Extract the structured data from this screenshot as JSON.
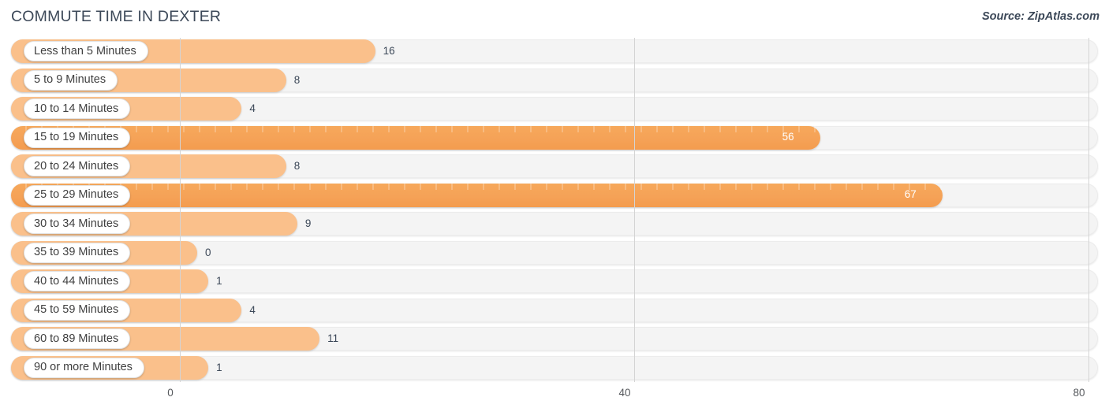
{
  "header": {
    "title": "COMMUTE TIME IN DEXTER",
    "source": "Source: ZipAtlas.com"
  },
  "chart_data": {
    "type": "bar",
    "orientation": "horizontal",
    "title": "COMMUTE TIME IN DEXTER",
    "subtitle": "",
    "source": "Source: ZipAtlas.com",
    "xlabel": "",
    "ylabel": "",
    "xlim": [
      0,
      80
    ],
    "xticks": [
      "0",
      "40",
      "80"
    ],
    "xtick_values": [
      0,
      40,
      80
    ],
    "grid": true,
    "legend": null,
    "categories": [
      "Less than 5 Minutes",
      "5 to 9 Minutes",
      "10 to 14 Minutes",
      "15 to 19 Minutes",
      "20 to 24 Minutes",
      "25 to 29 Minutes",
      "30 to 34 Minutes",
      "35 to 39 Minutes",
      "40 to 44 Minutes",
      "45 to 59 Minutes",
      "60 to 89 Minutes",
      "90 or more Minutes"
    ],
    "values": [
      16,
      8,
      4,
      56,
      8,
      67,
      9,
      0,
      1,
      4,
      11,
      1
    ],
    "colors": {
      "bar": "#fac08b",
      "bar_highlight": "#f5a257",
      "track": "#f4f4f4",
      "gridline": "#d4d4d4",
      "text": "#3c4858",
      "value_inside": "#ffffff"
    }
  },
  "rows": [
    {
      "label": "Less than 5 Minutes",
      "value": "16",
      "highlight": false
    },
    {
      "label": "5 to 9 Minutes",
      "value": "8",
      "highlight": false
    },
    {
      "label": "10 to 14 Minutes",
      "value": "4",
      "highlight": false
    },
    {
      "label": "15 to 19 Minutes",
      "value": "56",
      "highlight": true
    },
    {
      "label": "20 to 24 Minutes",
      "value": "8",
      "highlight": false
    },
    {
      "label": "25 to 29 Minutes",
      "value": "67",
      "highlight": true
    },
    {
      "label": "30 to 34 Minutes",
      "value": "9",
      "highlight": false
    },
    {
      "label": "35 to 39 Minutes",
      "value": "0",
      "highlight": false
    },
    {
      "label": "40 to 44 Minutes",
      "value": "1",
      "highlight": false
    },
    {
      "label": "45 to 59 Minutes",
      "value": "4",
      "highlight": false
    },
    {
      "label": "60 to 89 Minutes",
      "value": "11",
      "highlight": false
    },
    {
      "label": "90 or more Minutes",
      "value": "1",
      "highlight": false
    }
  ],
  "axis": {
    "ticks": [
      "0",
      "40",
      "80"
    ]
  }
}
